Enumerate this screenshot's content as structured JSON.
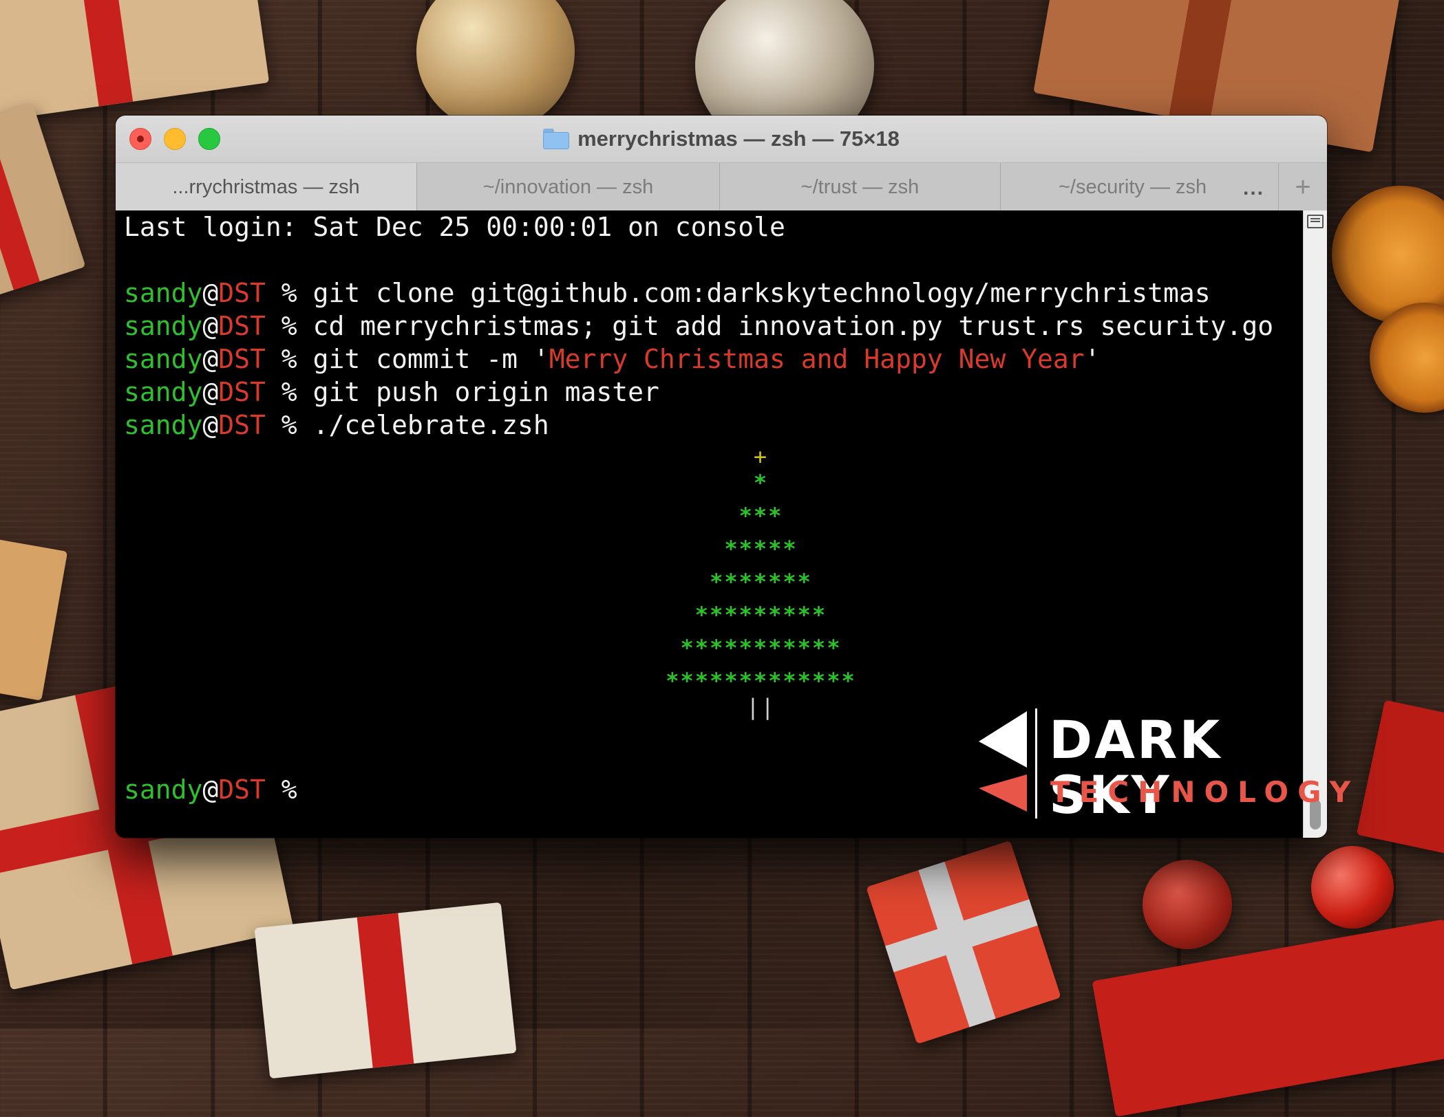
{
  "window": {
    "title": "merrychristmas — zsh — 75×18",
    "traffic_lights": [
      "close",
      "minimize",
      "maximize"
    ]
  },
  "tabs": [
    {
      "label": "...rrychristmas — zsh",
      "active": true
    },
    {
      "label": "~/innovation — zsh",
      "active": false
    },
    {
      "label": "~/trust — zsh",
      "active": false
    },
    {
      "label": "~/security — zsh",
      "active": false
    }
  ],
  "tabs_more": "...",
  "new_tab": "+",
  "terminal": {
    "last_login": "Last login: Sat Dec 25 00:00:01 on console",
    "prompt_user": "sandy",
    "prompt_at": "@",
    "prompt_host": "DST",
    "prompt_symbol": " % ",
    "commands": [
      "git clone git@github.com:darkskytechnology/merrychristmas",
      "cd merrychristmas; git add innovation.py trust.rs security.go",
      "git commit -m ",
      "git push origin master",
      "./celebrate.zsh"
    ],
    "commit_quote_open": "'",
    "commit_message": "Merry Christmas and Happy New Year",
    "commit_quote_close": "'",
    "tree": {
      "top": "+",
      "rows": [
        "*",
        "***",
        "*****",
        "*******",
        "*********",
        "***********",
        "*************"
      ],
      "trunk": "||"
    },
    "final_prompt_symbol": " %"
  },
  "logo": {
    "line1": "DARK SKY",
    "line2": "TECHNOLOGY"
  },
  "colors": {
    "prompt_user": "#2fbf2f",
    "prompt_host": "#d93a2b",
    "commit_message": "#d93a2b",
    "tree_star": "#c8c31a",
    "tree_branches": "#2bc12b",
    "logo_accent": "#e8564a"
  }
}
